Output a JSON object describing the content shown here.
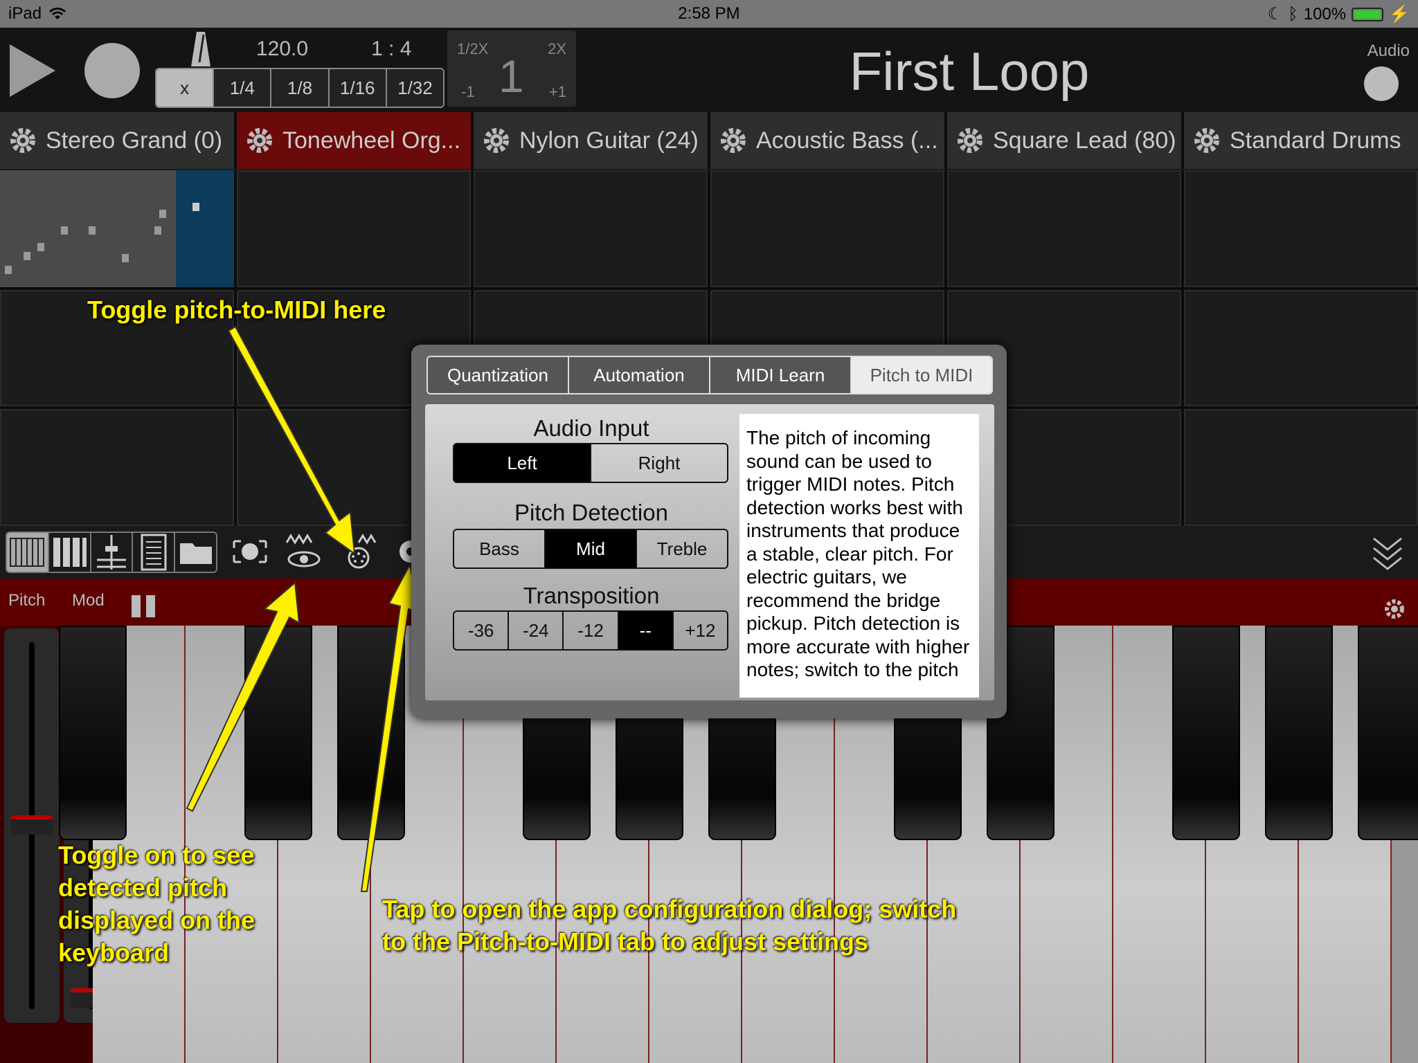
{
  "status_bar": {
    "device": "iPad",
    "time": "2:58 PM",
    "battery": "100%"
  },
  "transport": {
    "tempo": "120.0",
    "time_signature": "1 : 4",
    "quantize_options": [
      "x",
      "1/4",
      "1/8",
      "1/16",
      "1/32"
    ],
    "quantize_selected": "x"
  },
  "speed": {
    "half": "1/2X",
    "double": "2X",
    "value": "1",
    "minus": "-1",
    "plus": "+1"
  },
  "song_title": "First Loop",
  "audio_label": "Audio",
  "tracks": [
    {
      "name": "Stereo Grand (0)"
    },
    {
      "name": "Tonewheel Org..."
    },
    {
      "name": "Nylon Guitar (24)"
    },
    {
      "name": "Acoustic Bass (..."
    },
    {
      "name": "Square Lead (80)"
    },
    {
      "name": "Standard Drums"
    }
  ],
  "selected_track_index": 1,
  "keyboard_header": {
    "pitch": "Pitch",
    "mod": "Mod"
  },
  "wheels": {
    "pitch_level": 0.5,
    "mod_level": 0.0
  },
  "dialog": {
    "tabs": [
      "Quantization",
      "Automation",
      "MIDI Learn",
      "Pitch to MIDI"
    ],
    "active_tab": "Pitch to MIDI",
    "audio_input": {
      "label": "Audio Input",
      "options": [
        "Left",
        "Right"
      ],
      "selected": "Left"
    },
    "pitch_detection": {
      "label": "Pitch Detection",
      "options": [
        "Bass",
        "Mid",
        "Treble"
      ],
      "selected": "Mid"
    },
    "transposition": {
      "label": "Transposition",
      "options": [
        "-36",
        "-24",
        "-12",
        "--",
        "+12"
      ],
      "selected": "--"
    },
    "help_text": "The pitch of incoming sound can be used to trigger MIDI notes.  Pitch detection works best with instruments that produce a stable, clear pitch.  For electric guitars, we recommend the bridge pickup.  Pitch detection is more accurate with higher notes; switch to the pitch"
  },
  "annotations": {
    "toggle_pitch": "Toggle pitch-to-MIDI here",
    "see_pitch": [
      "Toggle on to see",
      "detected pitch",
      "displayed on the",
      "keyboard"
    ],
    "config": [
      "Tap to open the app configuration dialog; switch",
      "to the Pitch-to-MIDI tab to adjust settings"
    ]
  },
  "colors": {
    "accent_red": "#6a0a0a",
    "annotation_yellow": "#ffef00",
    "clip_cursor": "#0d3b5a"
  }
}
